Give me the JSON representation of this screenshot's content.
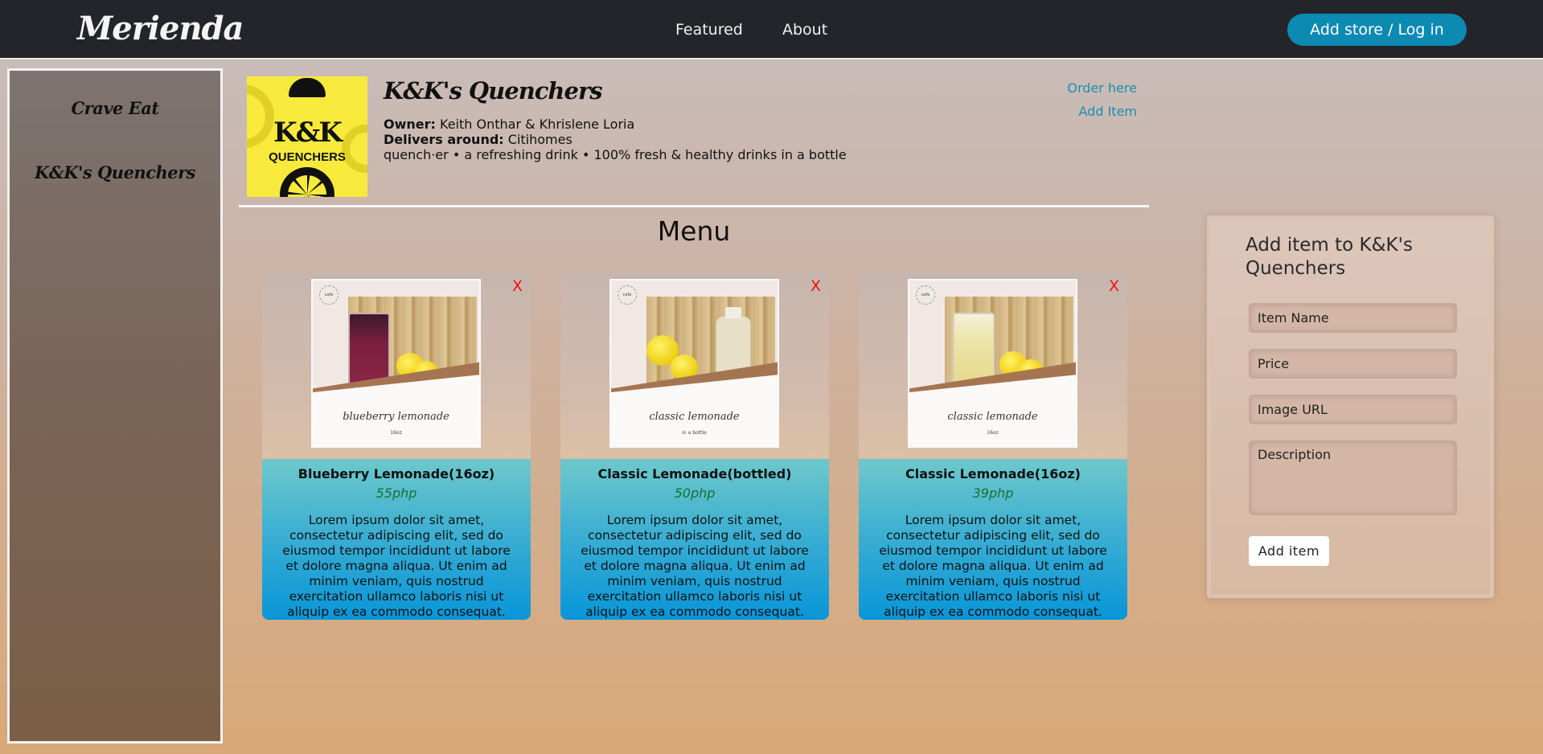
{
  "app": {
    "logo": "Merienda"
  },
  "nav": {
    "links": [
      "Featured",
      "About"
    ],
    "login_label": "Add store / Log in"
  },
  "sidebar": {
    "items": [
      {
        "label": "Crave Eat"
      },
      {
        "label": "K&K's Quenchers"
      }
    ]
  },
  "store": {
    "logo_text": {
      "monogram": "K&K",
      "word": "QUENCHERS"
    },
    "name": "K&K's Quenchers",
    "owner_label": "Owner:",
    "owner": "Keith Onthar & Khrislene Loria",
    "delivers_label": "Delivers around:",
    "delivers": "Citihomes",
    "description": "quench·er • a refreshing drink • 100% fresh & healthy drinks in a bottle",
    "actions": {
      "order": "Order here",
      "add_item": "Add Item"
    }
  },
  "menu": {
    "title": "Menu",
    "items": [
      {
        "name": "Blueberry Lemonade(16oz)",
        "price": "55php",
        "image_caption": "blueberry lemonade",
        "image_sub": "16oz",
        "badge": "cafe",
        "close": "X",
        "description": "Lorem ipsum dolor sit amet, consectetur adipiscing elit, sed do eiusmod tempor incididunt ut labore et dolore magna aliqua. Ut enim ad minim veniam, quis nostrud exercitation ullamco laboris nisi ut aliquip ex ea commodo consequat."
      },
      {
        "name": "Classic Lemonade(bottled)",
        "price": "50php",
        "image_caption": "classic lemonade",
        "image_sub": "in a bottle",
        "badge": "cafe",
        "close": "X",
        "description": "Lorem ipsum dolor sit amet, consectetur adipiscing elit, sed do eiusmod tempor incididunt ut labore et dolore magna aliqua. Ut enim ad minim veniam, quis nostrud exercitation ullamco laboris nisi ut aliquip ex ea commodo consequat."
      },
      {
        "name": "Classic Lemonade(16oz)",
        "price": "39php",
        "image_caption": "classic lemonade",
        "image_sub": "16oz",
        "badge": "cafe",
        "close": "X",
        "description": "Lorem ipsum dolor sit amet, consectetur adipiscing elit, sed do eiusmod tempor incididunt ut labore et dolore magna aliqua. Ut enim ad minim veniam, quis nostrud exercitation ullamco laboris nisi ut aliquip ex ea commodo consequat."
      }
    ]
  },
  "add_form": {
    "title": "Add item to K&K's Quenchers",
    "fields": {
      "name_placeholder": "Item Name",
      "price_placeholder": "Price",
      "image_placeholder": "Image URL",
      "description_placeholder": "Description"
    },
    "submit_label": "Add item"
  },
  "colors": {
    "topbar": "#24252b",
    "accent": "#0c8ab2",
    "link": "#1a8fb0",
    "price": "#17702e",
    "close": "#ee1111"
  }
}
